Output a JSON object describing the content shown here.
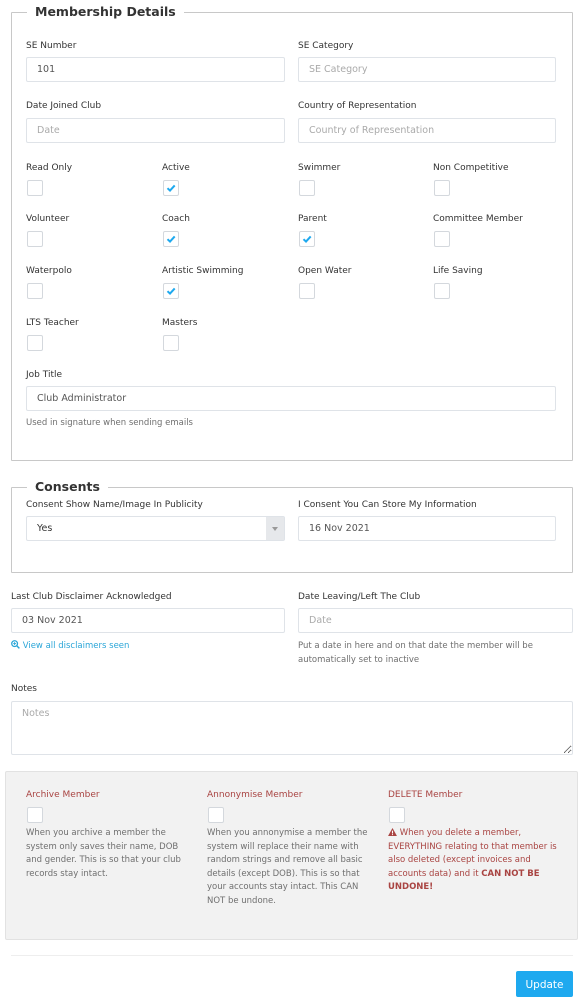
{
  "membership": {
    "legend": "Membership Details",
    "se_number": {
      "label": "SE Number",
      "value": "101",
      "placeholder": "SE Number"
    },
    "se_category": {
      "label": "SE Category",
      "value": "",
      "placeholder": "SE Category"
    },
    "date_joined": {
      "label": "Date Joined Club",
      "value": "",
      "placeholder": "Date"
    },
    "country": {
      "label": "Country of Representation",
      "value": "",
      "placeholder": "Country of Representation"
    },
    "checkboxes": [
      {
        "label": "Read Only",
        "checked": false
      },
      {
        "label": "Active",
        "checked": true
      },
      {
        "label": "Swimmer",
        "checked": false
      },
      {
        "label": "Non Competitive",
        "checked": false
      },
      {
        "label": "Volunteer",
        "checked": false
      },
      {
        "label": "Coach",
        "checked": true
      },
      {
        "label": "Parent",
        "checked": true
      },
      {
        "label": "Committee Member",
        "checked": false
      },
      {
        "label": "Waterpolo",
        "checked": false
      },
      {
        "label": "Artistic Swimming",
        "checked": true
      },
      {
        "label": "Open Water",
        "checked": false
      },
      {
        "label": "Life Saving",
        "checked": false
      },
      {
        "label": "LTS Teacher",
        "checked": false
      },
      {
        "label": "Masters",
        "checked": false
      }
    ],
    "job_title": {
      "label": "Job Title",
      "value": "Club Administrator",
      "help": "Used in signature when sending emails"
    }
  },
  "consents": {
    "legend": "Consents",
    "publicity": {
      "label": "Consent Show Name/Image In Publicity",
      "value": "Yes"
    },
    "store_info": {
      "label": "I Consent You Can Store My Information",
      "value": "16 Nov 2021"
    }
  },
  "disclaimer": {
    "label": "Last Club Disclaimer Acknowledged",
    "value": "03 Nov 2021",
    "link": "View all disclaimers seen"
  },
  "leaving": {
    "label": "Date Leaving/Left The Club",
    "value": "",
    "placeholder": "Date",
    "help": "Put a date in here and on that date the member will be automatically set to inactive"
  },
  "notes": {
    "label": "Notes",
    "value": "",
    "placeholder": "Notes"
  },
  "danger": {
    "archive": {
      "title": "Archive Member",
      "checked": false,
      "text": "When you archive a member the system only saves their name, DOB and gender. This is so that your club records stay intact."
    },
    "anonymise": {
      "title": "Annonymise Member",
      "checked": false,
      "text": "When you annonymise a member the system will replace their name with random strings and remove all basic details (except DOB). This is so that your accounts stay intact. This CAN NOT be undone."
    },
    "delete": {
      "title": "DELETE Member",
      "checked": false,
      "text": "When you delete a member, EVERYTHING relating to that member is also deleted (except invoices and accounts data) and it",
      "text_bold": "CAN NOT BE UNDONE!"
    }
  },
  "actions": {
    "update_label": "Update"
  },
  "colors": {
    "accent": "#1ea9ef",
    "danger": "#a94442",
    "link": "#2ba6d8"
  }
}
